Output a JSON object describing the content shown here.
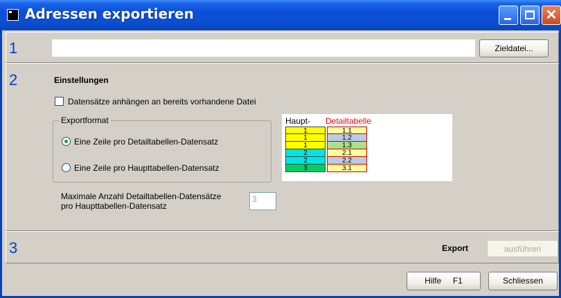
{
  "window": {
    "title": "Adressen exportieren",
    "controls": {
      "minimize": "minimize-icon",
      "maximize": "maximize-icon",
      "close": "close-icon",
      "close_glyph": "✕"
    }
  },
  "step1": {
    "number": "1",
    "target_path": "",
    "target_button": "Zieldatei..."
  },
  "step2": {
    "number": "2",
    "heading": "Einstellungen",
    "append_checkbox": {
      "label": "Datensätze anhängen an bereits vorhandene Datei",
      "checked": false
    },
    "exportformat": {
      "legend": "Exportformat",
      "options": [
        {
          "label": "Eine Zeile pro Detailtabellen-Datensatz",
          "selected": true
        },
        {
          "label": "Eine Zeile pro Haupttabellen-Datensatz",
          "selected": false
        }
      ]
    },
    "preview": {
      "col_main": "Haupt-",
      "col_detail": "Detailtabelle",
      "rows": [
        {
          "main": "1",
          "detail": "1.1",
          "main_color": "#ffff00",
          "detail_color": "#ffff99"
        },
        {
          "main": "1",
          "detail": "1.2",
          "main_color": "#ffff00",
          "detail_color": "#b8cce4"
        },
        {
          "main": "1",
          "detail": "1.3",
          "main_color": "#ffff00",
          "detail_color": "#a9e28a"
        },
        {
          "main": "2",
          "detail": "2.1",
          "main_color": "#00e5e5",
          "detail_color": "#ffff99"
        },
        {
          "main": "2",
          "detail": "2.2",
          "main_color": "#00e5e5",
          "detail_color": "#b8cce4"
        },
        {
          "main": "3",
          "detail": "3.1",
          "main_color": "#00d060",
          "detail_color": "#ffff99"
        }
      ]
    },
    "max_label_line1": "Maximale Anzahl Detailtabellen-Datensätze",
    "max_label_line2": "pro Haupttabellen-Datensatz",
    "max_value": "3"
  },
  "step3": {
    "number": "3",
    "export_label": "Export",
    "run_button": "ausführen"
  },
  "footer": {
    "help_button": "Hilfe     F1",
    "close_button": "Schliessen"
  },
  "colors": {
    "accent_blue": "#0041c8",
    "detail_header_red": "#ff0000",
    "preview_border_red": "#cc0000"
  }
}
